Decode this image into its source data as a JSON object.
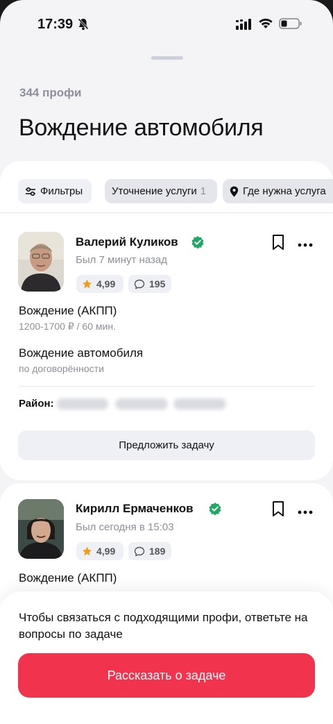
{
  "status_bar": {
    "time": "17:39",
    "icons": [
      "bell-slash-icon",
      "signal-icon",
      "wifi-icon",
      "battery-icon"
    ]
  },
  "header": {
    "count": "344 профи",
    "title": "Вождение автомобиля"
  },
  "filters": {
    "filters_label": "Фильтры",
    "specify_label": "Уточнение услуги",
    "specify_count": "1",
    "where_label": "Где нужна услуга"
  },
  "specialists": [
    {
      "name": "Валерий Куликов",
      "last_seen": "Был 7 минут назад",
      "rating": "4,99",
      "reviews": "195",
      "services": [
        {
          "title": "Вождение (АКПП)",
          "price": "1200-1700 ₽ / 60 мин."
        },
        {
          "title": "Вождение автомобиля",
          "price": "по договорённости"
        }
      ],
      "district_label": "Район:",
      "offer_label": "Предложить задачу"
    },
    {
      "name": "Кирилл Ермаченков",
      "last_seen": "Был сегодня в 15:03",
      "rating": "4,99",
      "reviews": "189",
      "services": [
        {
          "title": "Вождение (АКПП)"
        }
      ]
    }
  ],
  "bottom_sheet": {
    "prompt": "Чтобы связаться с подходящими профи, ответьте на вопросы по задаче",
    "cta_label": "Рассказать о задаче"
  },
  "colors": {
    "accent": "#f2334e",
    "verified": "#21a764",
    "star": "#f29c1c",
    "chip_bg": "#eef0f6"
  }
}
